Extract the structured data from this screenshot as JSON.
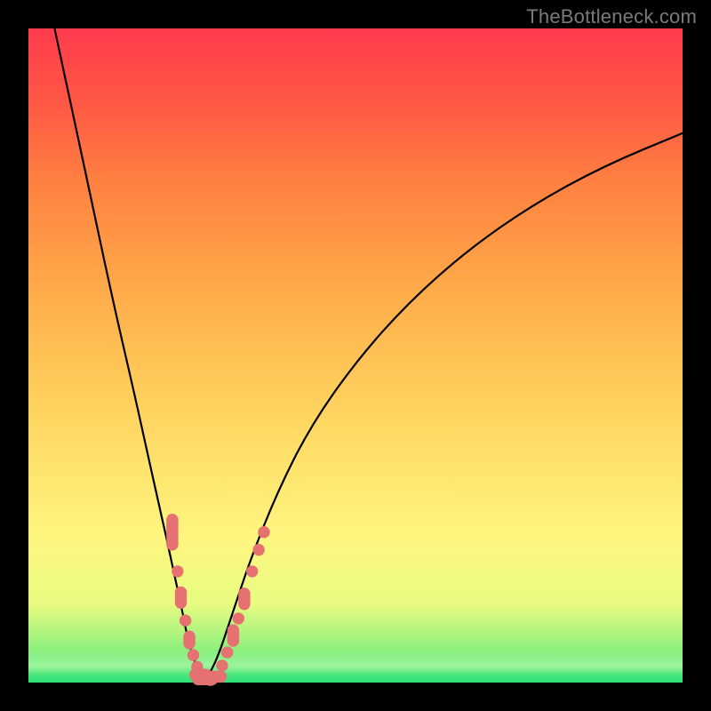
{
  "watermark": "TheBottleneck.com",
  "colors": {
    "frame": "#000000",
    "curve": "#000000",
    "marker": "#e57171",
    "gradient_top": "#ff3b4e",
    "gradient_mid": "#fef680",
    "gradient_bottom": "#2fe27a"
  },
  "chart_data": {
    "type": "line",
    "title": "",
    "xlabel": "",
    "ylabel": "",
    "xlim": [
      0,
      100
    ],
    "ylim": [
      0,
      100
    ],
    "grid": false,
    "legend": false,
    "series": [
      {
        "name": "left-branch",
        "x": [
          4,
          7,
          10,
          13,
          16,
          18,
          20,
          22,
          23.5,
          24.5,
          25.5,
          26.2,
          26.8
        ],
        "y": [
          100,
          86,
          72,
          58,
          45,
          36,
          27,
          18,
          11,
          6,
          3,
          1,
          0
        ]
      },
      {
        "name": "right-branch",
        "x": [
          26.8,
          27.5,
          29,
          31,
          34,
          38,
          43,
          50,
          58,
          67,
          77,
          88,
          100
        ],
        "y": [
          0,
          1,
          4,
          10,
          19,
          29,
          39,
          49,
          58,
          66,
          73,
          79,
          84
        ]
      }
    ],
    "markers": [
      {
        "x": 22.0,
        "y": 23,
        "shape": "pill-vertical",
        "len": 10
      },
      {
        "x": 22.8,
        "y": 17,
        "shape": "dot"
      },
      {
        "x": 23.3,
        "y": 13,
        "shape": "pill-vertical",
        "len": 6
      },
      {
        "x": 24.0,
        "y": 9.5,
        "shape": "dot"
      },
      {
        "x": 24.6,
        "y": 6.5,
        "shape": "pill-vertical",
        "len": 5
      },
      {
        "x": 25.2,
        "y": 4.2,
        "shape": "dot"
      },
      {
        "x": 25.8,
        "y": 2.4,
        "shape": "dot"
      },
      {
        "x": 26.3,
        "y": 1.2,
        "shape": "pill-horizontal",
        "len": 6
      },
      {
        "x": 27.0,
        "y": 0.5,
        "shape": "pill-horizontal",
        "len": 7
      },
      {
        "x": 27.8,
        "y": 0.4,
        "shape": "dot"
      },
      {
        "x": 28.6,
        "y": 0.9,
        "shape": "pill-horizontal",
        "len": 6
      },
      {
        "x": 29.6,
        "y": 2.6,
        "shape": "dot"
      },
      {
        "x": 30.4,
        "y": 4.6,
        "shape": "dot"
      },
      {
        "x": 31.3,
        "y": 7.2,
        "shape": "pill-vertical",
        "len": 6
      },
      {
        "x": 32.1,
        "y": 9.8,
        "shape": "dot"
      },
      {
        "x": 33.0,
        "y": 12.8,
        "shape": "pill-vertical",
        "len": 6
      },
      {
        "x": 34.2,
        "y": 17.0,
        "shape": "dot"
      },
      {
        "x": 35.2,
        "y": 20.3,
        "shape": "dot"
      },
      {
        "x": 36.0,
        "y": 23.0,
        "shape": "dot"
      }
    ]
  }
}
